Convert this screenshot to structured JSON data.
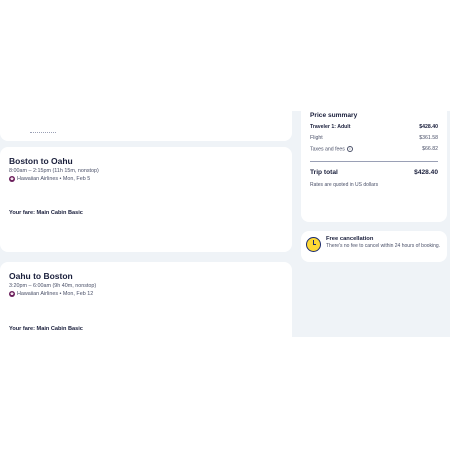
{
  "flights": [
    {
      "title": "Boston to Oahu",
      "time": "8:00am – 2:15pm (11h 15m, nonstop)",
      "airline": "Hawaiian Airlines • Mon, Feb 5",
      "fare": "Your fare: Main Cabin Basic"
    },
    {
      "title": "Oahu to Boston",
      "time": "3:20pm – 6:00am (9h 40m, nonstop)",
      "airline": "Hawaiian Airlines • Mon, Feb 12",
      "fare": "Your fare: Main Cabin Basic"
    }
  ],
  "summary": {
    "title": "Price summary",
    "traveler_label": "Traveler 1: Adult",
    "traveler_value": "$428.40",
    "flight_label": "Flight",
    "flight_value": "$361.58",
    "taxes_label": "Taxes and fees",
    "taxes_value": "$66.82",
    "total_label": "Trip total",
    "total_value": "$428.40",
    "note": "Rates are quoted in US dollars"
  },
  "cancellation": {
    "title": "Free cancellation",
    "description": "There's no fee to cancel within 24 hours of booking."
  },
  "icons": {
    "airline_logo": "hawaiian-airlines-logo",
    "info": "info-icon",
    "clock": "clock-icon"
  }
}
